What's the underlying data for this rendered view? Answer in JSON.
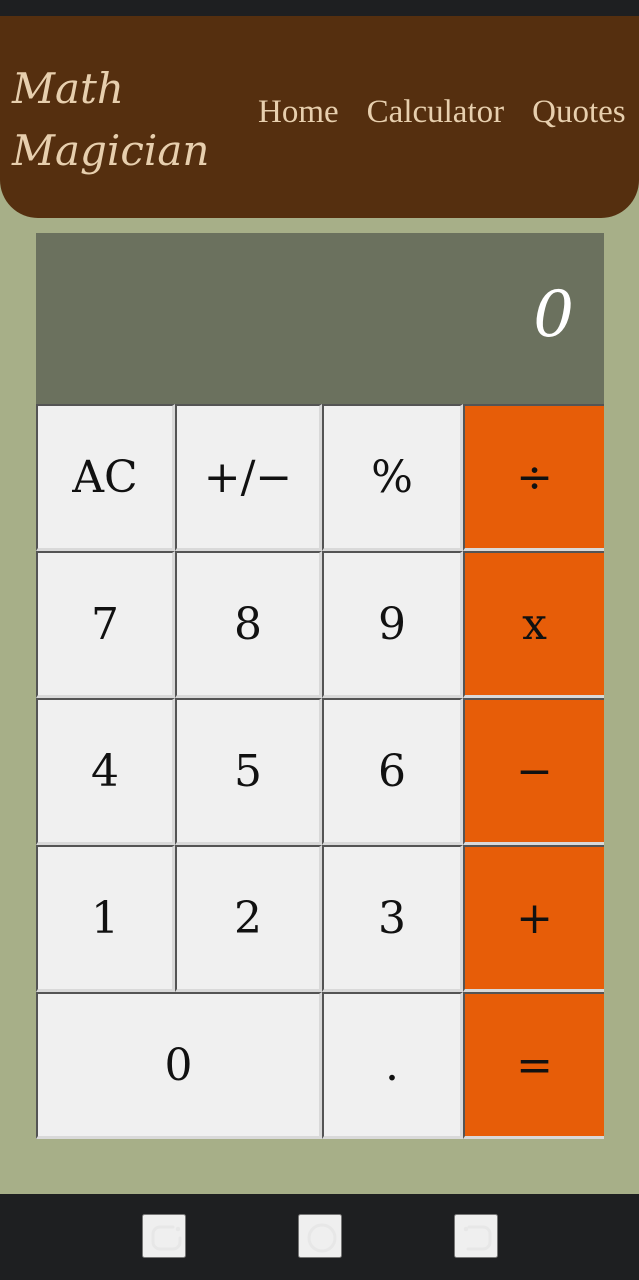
{
  "header": {
    "brand_line_1": "Math",
    "brand_line_2": "Magician",
    "nav": {
      "home": "Home",
      "calculator": "Calculator",
      "quotes": "Quotes"
    }
  },
  "calculator": {
    "display_value": "0",
    "keys": {
      "ac": "AC",
      "plus_minus": "+/−",
      "percent": "%",
      "divide": "÷",
      "seven": "7",
      "eight": "8",
      "nine": "9",
      "multiply": "x",
      "four": "4",
      "five": "5",
      "six": "6",
      "minus": "−",
      "one": "1",
      "two": "2",
      "three": "3",
      "plus": "+",
      "zero": "0",
      "decimal": ".",
      "equals": "="
    }
  },
  "icons": {
    "recent_apps": "recent-apps-icon",
    "home": "home-circle-icon",
    "back": "back-icon"
  },
  "colors": {
    "page_background": "#a7af88",
    "header_background": "#552f0f",
    "header_text": "#e7cfae",
    "display_background": "#6b715e",
    "key_background": "#f0f0f0",
    "operator_background": "#e75d08",
    "system_bar": "#1e1f21"
  }
}
